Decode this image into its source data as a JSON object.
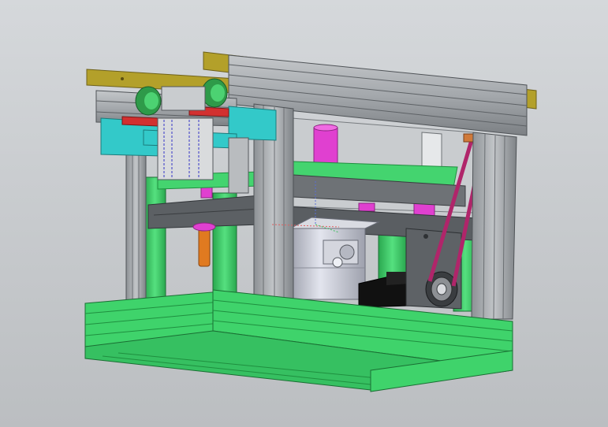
{
  "viewport": {
    "background_top": "#d5d8db",
    "background_bottom": "#bbbec1"
  },
  "colors": {
    "aluminum_profile": "#a8acb0",
    "aluminum_profile_dark": "#6f7377",
    "base_frame": "#3fd36b",
    "base_frame_dark": "#1f8f3f",
    "top_rail": "#b3a02a",
    "bracket_cyan": "#33c9c9",
    "part_magenta": "#e040d0",
    "part_red": "#d23030",
    "part_orange": "#e07a20",
    "belt": "#b0256a",
    "plate_dark": "#5a5e62",
    "motor_silver": "#c9ccd6"
  },
  "model": {
    "components": [
      "top-aluminum-frame",
      "base-aluminum-frame",
      "top-rail",
      "linear-bearing-blocks",
      "mounting-plate",
      "stepper-motor",
      "timing-belt",
      "pulley",
      "guide-rods",
      "base-plate"
    ]
  }
}
